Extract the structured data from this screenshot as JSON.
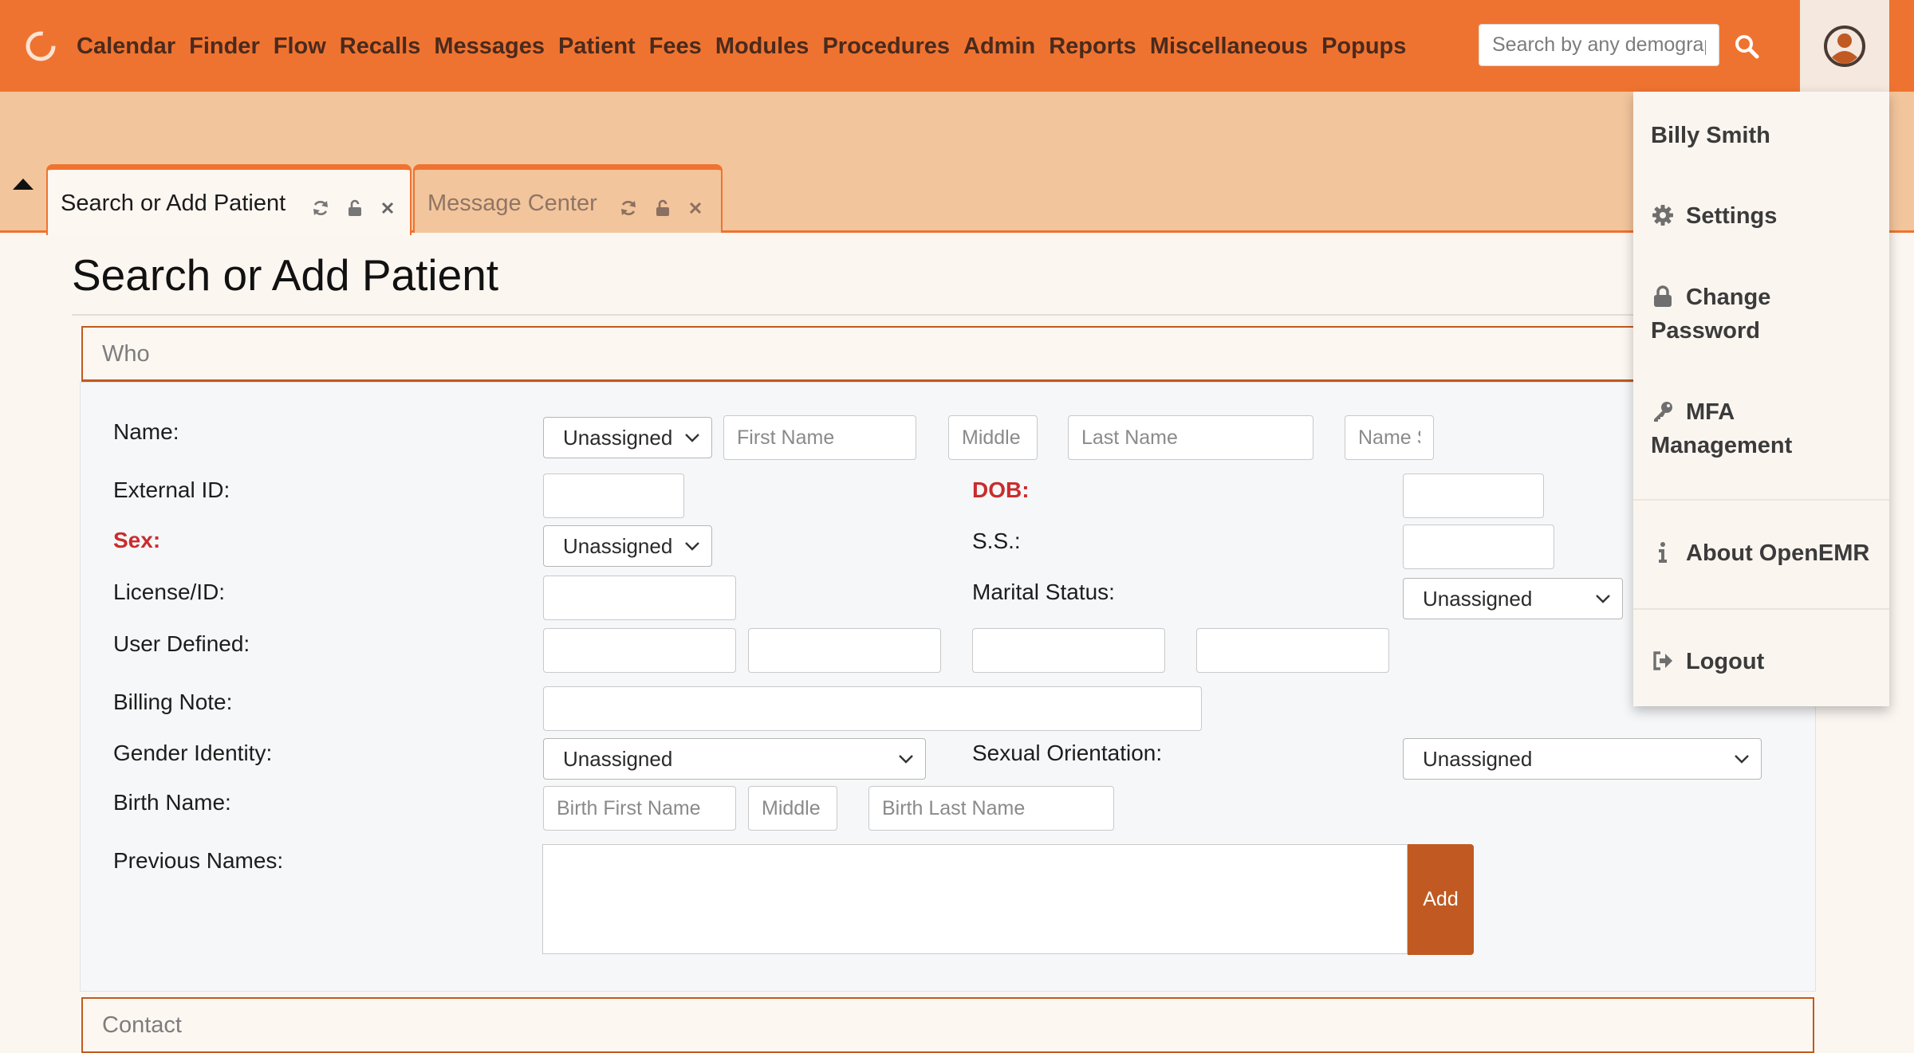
{
  "nav": {
    "items": [
      "Calendar",
      "Finder",
      "Flow",
      "Recalls",
      "Messages",
      "Patient",
      "Fees",
      "Modules",
      "Procedures",
      "Admin",
      "Reports",
      "Miscellaneous",
      "Popups"
    ],
    "search_placeholder": "Search by any demographics"
  },
  "tabs": [
    {
      "label": "Search or Add Patient",
      "active": true
    },
    {
      "label": "Message Center",
      "active": false
    }
  ],
  "page": {
    "title": "Search or Add Patient"
  },
  "who": {
    "header": "Who",
    "labels": {
      "name": "Name:",
      "external_id": "External ID:",
      "dob": "DOB:",
      "sex": "Sex:",
      "ss": "S.S.:",
      "license": "License/ID:",
      "marital": "Marital Status:",
      "user_defined": "User Defined:",
      "billing_note": "Billing Note:",
      "gender_identity": "Gender Identity:",
      "sexual_orientation": "Sexual Orientation:",
      "birth_name": "Birth Name:",
      "previous_names": "Previous Names:"
    },
    "placeholders": {
      "first_name": "First Name",
      "middle": "Middle",
      "last_name": "Last Name",
      "suffix": "Name Suffix",
      "birth_first": "Birth First Name",
      "birth_middle": "Middle",
      "birth_last": "Birth Last Name"
    },
    "selects": {
      "title": "Unassigned",
      "sex": "Unassigned",
      "marital": "Unassigned",
      "gender_identity": "Unassigned",
      "sexual_orientation": "Unassigned"
    },
    "add_button": "Add"
  },
  "contact": {
    "header": "Contact"
  },
  "user_menu": {
    "name": "Billy Smith",
    "settings": "Settings",
    "change_password_1": "Change",
    "change_password_2": "Password",
    "mfa_1": "MFA",
    "mfa_2": "Management",
    "about": "About OpenEMR",
    "logout": "Logout"
  },
  "colors": {
    "primary": "#ef7330",
    "tab_band": "#f3c59c",
    "required": "#c92d2d",
    "button": "#c05a22"
  }
}
